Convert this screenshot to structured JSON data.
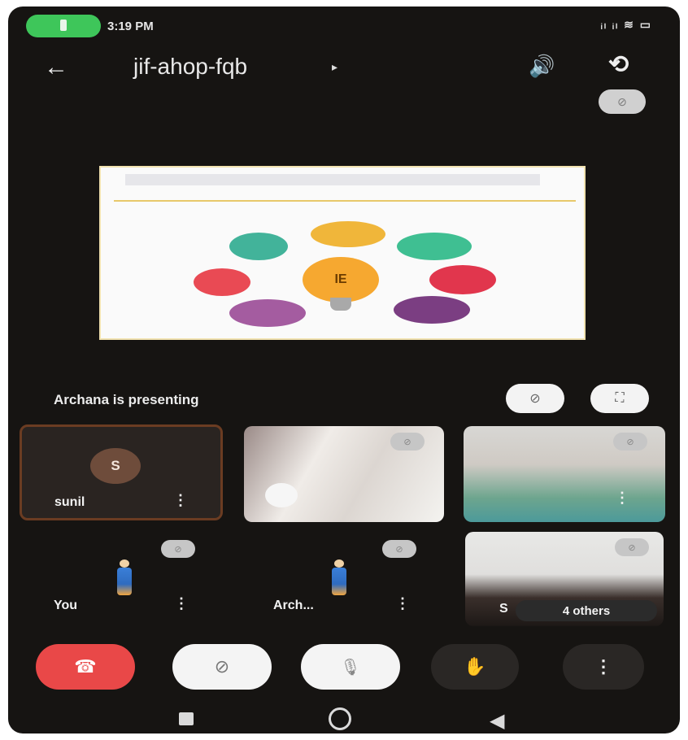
{
  "status_bar": {
    "time": "3:19 PM",
    "right_icons": "ᵢₗ ᵢₗ ≋ ▭"
  },
  "header": {
    "back_icon": "←",
    "meeting_code": "jif-ahop-fqb",
    "caret": "▸",
    "speaker_icon": "🔊",
    "switch_camera_icon": "⟲"
  },
  "slide": {
    "center_label": "IE"
  },
  "presenting": {
    "text": "Archana is presenting"
  },
  "participants": [
    {
      "name": "sunil",
      "initial": "S"
    },
    {
      "name": "You"
    },
    {
      "name": "Arch..."
    },
    {
      "name": "S"
    }
  ],
  "overflow": {
    "label": "4 others"
  },
  "controls": {
    "end_call_icon": "☎",
    "camera_icon": "⊘",
    "mic_icon": "🎙",
    "hand_icon": "✋",
    "more_icon": "⋮"
  },
  "colors": {
    "end_call": "#e94848",
    "call_pill": "#3ec65a",
    "active_border": "#6b3c22"
  },
  "icons": [
    "back-arrow-icon",
    "speaker-icon",
    "switch-camera-icon",
    "mic-off-icon",
    "fullscreen-icon",
    "more-vert-icon",
    "end-call-icon",
    "camera-off-icon",
    "raise-hand-icon"
  ]
}
